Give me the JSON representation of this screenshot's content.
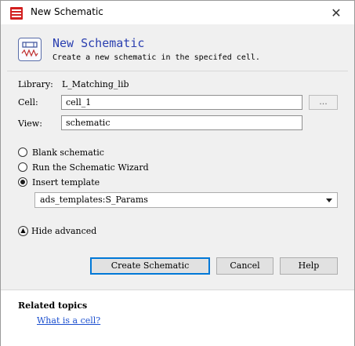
{
  "window": {
    "title": "New Schematic"
  },
  "header": {
    "title": "New Schematic",
    "subtitle": "Create a new schematic in the specifed cell."
  },
  "form": {
    "library_label": "Library:",
    "library_value": "L_Matching_lib",
    "cell_label": "Cell:",
    "cell_value": "cell_1",
    "browse_label": "...",
    "view_label": "View:",
    "view_value": "schematic"
  },
  "options": {
    "blank_label": "Blank schematic",
    "wizard_label": "Run the Schematic Wizard",
    "template_label": "Insert template",
    "selected": "Insert template",
    "template_value": "ads_templates:S_Params"
  },
  "advanced": {
    "label": "Hide advanced"
  },
  "buttons": {
    "create": "Create Schematic",
    "cancel": "Cancel",
    "help": "Help"
  },
  "related": {
    "title": "Related topics",
    "link": "What is a cell?"
  },
  "colors": {
    "header_title": "#2a3fb0",
    "link": "#1b4fcf",
    "app_icon": "#d21f1f",
    "focus_border": "#0078d7"
  }
}
